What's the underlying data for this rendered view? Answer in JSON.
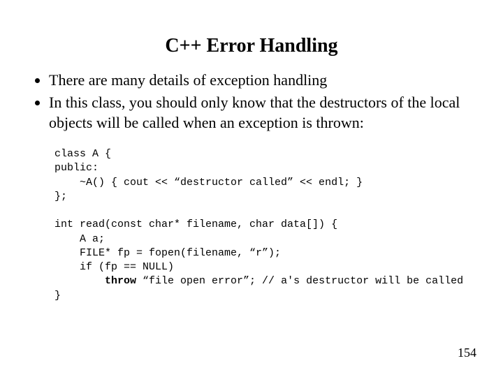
{
  "title": "C++ Error Handling",
  "bullets": [
    "There are many details of exception handling",
    "In this class, you should only know that the destructors of the local objects will be called when an exception is thrown:"
  ],
  "code": {
    "l1": "class A {",
    "l2": "public:",
    "l3": "    ~A() { cout << “destructor called” << endl; }",
    "l4": "};",
    "l5": "",
    "l6": "int read(const char* filename, char data[]) {",
    "l7": "    A a;",
    "l8": "    FILE* fp = fopen(filename, “r”);",
    "l9": "    if (fp == NULL)",
    "l10a": "        ",
    "l10b": "throw",
    "l10c": " “file open error”; // a's destructor will be called",
    "l11": "}"
  },
  "page_number": "154"
}
